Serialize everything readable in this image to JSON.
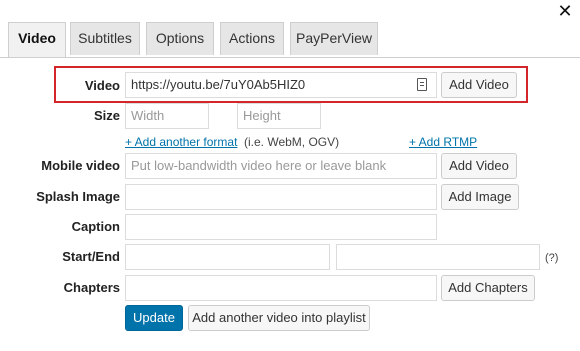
{
  "tabs": [
    {
      "label": "Video",
      "active": true
    },
    {
      "label": "Subtitles",
      "active": false
    },
    {
      "label": "Options",
      "active": false
    },
    {
      "label": "Actions",
      "active": false
    },
    {
      "label": "PayPerView",
      "active": false
    }
  ],
  "close_icon": "close-icon",
  "form": {
    "video": {
      "label": "Video",
      "value": "https://youtu.be/7uY0Ab5HIZ0",
      "button": "Add Video"
    },
    "size": {
      "label": "Size",
      "width_placeholder": "Width",
      "height_placeholder": "Height"
    },
    "formats": {
      "link": "+ Add another format",
      "note": "(i.e. WebM, OGV)",
      "rtmp_link": "+ Add RTMP"
    },
    "mobile": {
      "label": "Mobile video",
      "placeholder": "Put low-bandwidth video here or leave blank",
      "button": "Add Video"
    },
    "splash": {
      "label": "Splash Image",
      "value": "",
      "button": "Add Image"
    },
    "caption": {
      "label": "Caption",
      "value": ""
    },
    "start_end": {
      "label": "Start/End",
      "start": "",
      "end": "",
      "help": "(?)"
    },
    "chapters": {
      "label": "Chapters",
      "value": "",
      "button": "Add Chapters"
    },
    "actions": {
      "update": "Update",
      "add_playlist": "Add another video into playlist"
    }
  },
  "colors": {
    "highlight": "#d2262a",
    "primary": "#0073aa",
    "link": "#0073aa"
  }
}
